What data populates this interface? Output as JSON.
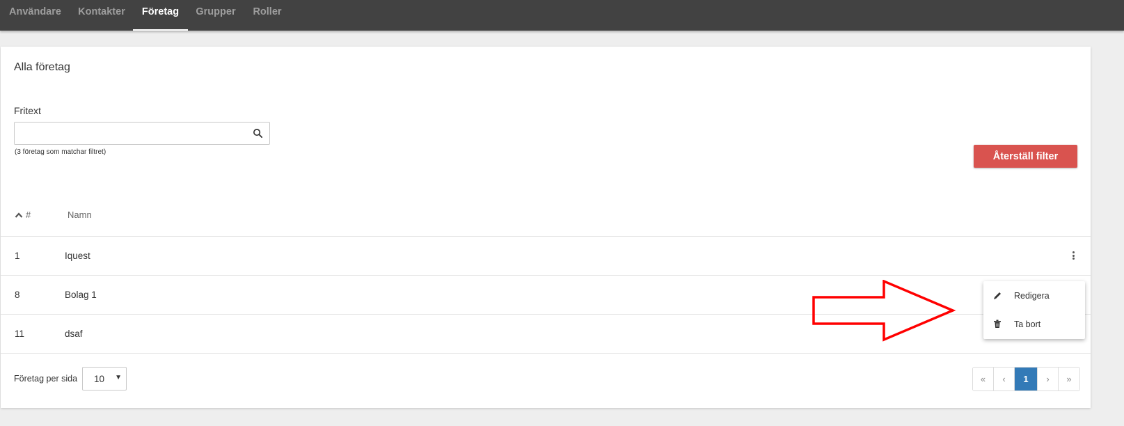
{
  "nav": {
    "tabs": [
      {
        "label": "Användare",
        "active": false
      },
      {
        "label": "Kontakter",
        "active": false
      },
      {
        "label": "Företag",
        "active": true
      },
      {
        "label": "Grupper",
        "active": false
      },
      {
        "label": "Roller",
        "active": false
      }
    ]
  },
  "panel": {
    "title": "Alla företag",
    "filter_label": "Fritext",
    "search_value": "",
    "search_icon": "search-icon",
    "match_count": "(3 företag som matchar filtret)",
    "reset_button": "Återställ filter"
  },
  "table": {
    "columns": [
      "#",
      "Namn"
    ],
    "sort_icon": "chevron-up-icon",
    "rows": [
      {
        "id": "1",
        "name": "Iquest"
      },
      {
        "id": "8",
        "name": "Bolag 1"
      },
      {
        "id": "11",
        "name": "dsaf"
      }
    ]
  },
  "footer": {
    "per_page_label": "Företag per sida",
    "per_page_value": "10",
    "pager": [
      "«",
      "‹",
      "1",
      "›",
      "»"
    ],
    "current_page": "1"
  },
  "context_menu": {
    "items": [
      {
        "label": "Redigera",
        "icon": "pencil-icon"
      },
      {
        "label": "Ta bort",
        "icon": "trash-icon"
      }
    ]
  },
  "colors": {
    "nav_bg": "#424242",
    "danger": "#d9534f",
    "primary": "#337ab7",
    "annotation_arrow": "#ff0000"
  }
}
